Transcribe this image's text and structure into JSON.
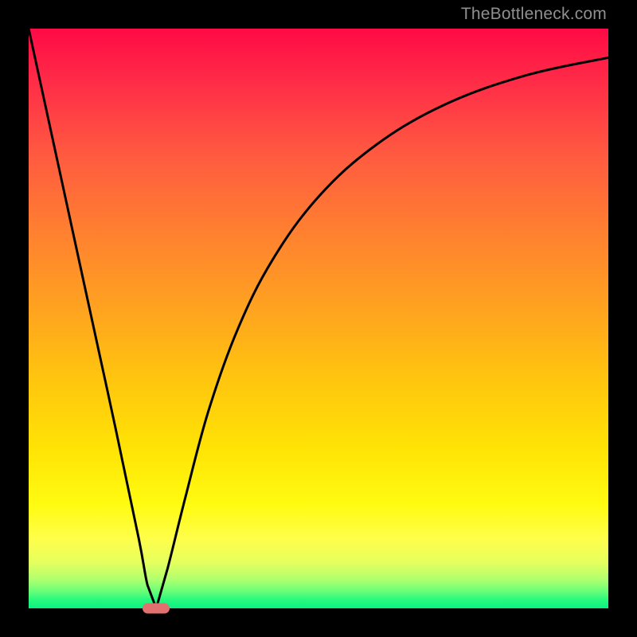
{
  "watermark": "TheBottleneck.com",
  "chart_data": {
    "type": "line",
    "title": "",
    "xlabel": "",
    "ylabel": "",
    "xlim": [
      0,
      100
    ],
    "ylim": [
      0,
      100
    ],
    "grid": false,
    "series": [
      {
        "name": "curve",
        "x": [
          0,
          5,
          10,
          15,
          19,
          20.5,
          22,
          24,
          27,
          31,
          36,
          42,
          50,
          60,
          72,
          86,
          100
        ],
        "values": [
          100,
          77,
          54,
          31,
          12,
          4,
          0,
          7,
          19,
          34,
          48,
          60,
          71,
          80,
          87,
          92,
          95
        ]
      }
    ],
    "annotations": [
      {
        "kind": "marker-pill",
        "x": 22,
        "y": 0,
        "color": "#e2706f"
      }
    ],
    "background_gradient": {
      "direction": "vertical",
      "stops": [
        {
          "pos": 0,
          "color": "#ff0a46"
        },
        {
          "pos": 50,
          "color": "#ffa220"
        },
        {
          "pos": 82,
          "color": "#fffb10"
        },
        {
          "pos": 100,
          "color": "#0af07f"
        }
      ]
    }
  }
}
